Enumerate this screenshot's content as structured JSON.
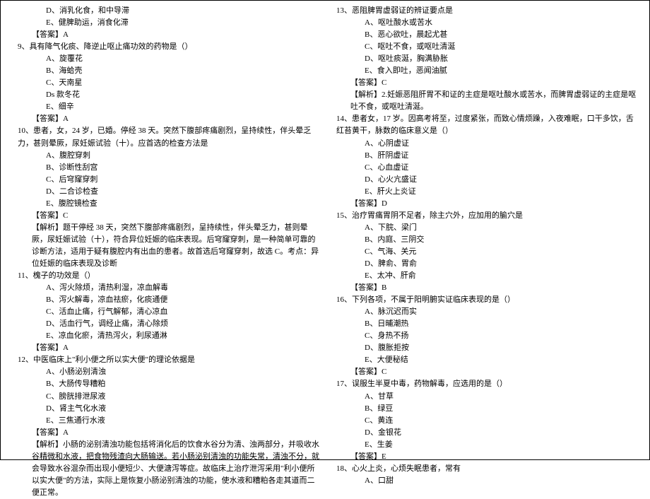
{
  "left": [
    {
      "cls": "indent2",
      "t": "D、消乳化食，和中导滞"
    },
    {
      "cls": "indent2",
      "t": "E、健脾助运，消食化滞"
    },
    {
      "cls": "indent1",
      "t": "【答案】A"
    },
    {
      "cls": "q",
      "t": "9、具有降气化痰、降逆止呕止痛功效的药物是（）"
    },
    {
      "cls": "indent2",
      "t": "A、旋覆花"
    },
    {
      "cls": "indent2",
      "t": "B、海蛤壳"
    },
    {
      "cls": "indent2",
      "t": "C、天南星"
    },
    {
      "cls": "indent2",
      "t": "Ds 款冬花"
    },
    {
      "cls": "indent2",
      "t": "E、细辛"
    },
    {
      "cls": "indent1",
      "t": "【答案】A"
    },
    {
      "cls": "q",
      "t": "10、患者，女，24 岁，已婚。停经 38 天。突然下腹部疼痛剧烈，呈持续性，伴头晕乏力，甚则晕厥，尿妊娠试验（十）。应首选的检查方法是"
    },
    {
      "cls": "indent2",
      "t": "A、腹腔穿刺"
    },
    {
      "cls": "indent2",
      "t": "B、诊断性刮宫"
    },
    {
      "cls": "indent2",
      "t": "C、后穹窿穿刺"
    },
    {
      "cls": "indent2",
      "t": "D、二合诊检查"
    },
    {
      "cls": "indent2",
      "t": "E、腹腔镜检查"
    },
    {
      "cls": "indent1",
      "t": "【答案】C"
    },
    {
      "cls": "indent1",
      "t": "【解析】题干停经 38 天，突然下腹部疼痛剧烈，呈持续性，伴头晕乏力，甚则晕厥，尿妊娠试验（十），符合异位妊娠的临床表现。后穹窿穿刺，是一种简单可靠的诊断方法，适用于疑有腹腔内有出血的患者。故首选后穹窿穿刺，故选 C。考点：异位妊娠的临床表现及诊断"
    },
    {
      "cls": "q",
      "t": "11、槐子的功效是（）"
    },
    {
      "cls": "indent2",
      "t": "A、泻火除烦，清热利湿，凉血解毒"
    },
    {
      "cls": "indent2",
      "t": "B、泻火解毒，凉血祛瘀，化痰通便"
    },
    {
      "cls": "indent2",
      "t": "C、活血止痛，行气解郁，清心凉血"
    },
    {
      "cls": "indent2",
      "t": "D、活血行气，调经止痛，清心除烦"
    },
    {
      "cls": "indent2",
      "t": "E、凉血化瘀，清热泻火，利尿通淋"
    },
    {
      "cls": "indent1",
      "t": "【答案】A"
    },
    {
      "cls": "q",
      "t": "12、中医临床上\"利小便之所以实大便\"的理论依据是"
    },
    {
      "cls": "indent2",
      "t": "A、小肠泌别清浊"
    },
    {
      "cls": "indent2",
      "t": "B、大肠传导糟粕"
    },
    {
      "cls": "indent2",
      "t": "C、膀胱排泄尿液"
    },
    {
      "cls": "indent2",
      "t": "D、肾主气化水液"
    },
    {
      "cls": "indent2",
      "t": "E、三焦通行水液"
    },
    {
      "cls": "indent1",
      "t": "【答案】A"
    },
    {
      "cls": "indent1",
      "t": "【解析】小肠的泌别清浊功能包括将消化后的饮食水谷分为清、浊两部分，并吸收水谷精微和水液，把食物残渣向大肠输送。若小肠泌别清浊的功能失常，清浊不分，就会导致水谷混杂而出现小便短少、大便溏泻等症。故临床上治疗泄泻采用\"利小便所以实大便\"的方法，实际上是恢复小肠泌别清浊的功能，使水液和糟粕各走其道而二便正常。"
    }
  ],
  "right": [
    {
      "cls": "q",
      "t": "13、恶阻脾胃虚弱证的辨证要点是"
    },
    {
      "cls": "indent2",
      "t": "A、呕吐酸水或苦水"
    },
    {
      "cls": "indent2",
      "t": "B、恶心欲吐，晨起尤甚"
    },
    {
      "cls": "indent2",
      "t": "C、呕吐不食，或呕吐清涎"
    },
    {
      "cls": "indent2",
      "t": "D、呕吐痰涎，胸满胁胀"
    },
    {
      "cls": "indent2",
      "t": "E、食入即吐，恶闻油腻"
    },
    {
      "cls": "indent1",
      "t": "【答案】C"
    },
    {
      "cls": "indent1",
      "t": "【解析】2.妊娠恶阻肝胃不和证的主症是呕吐酸水或苦水，而脾胃虚弱证的主症是呕吐不食，或呕吐清涎。"
    },
    {
      "cls": "q",
      "t": "14、患者女，17 岁。因高考将至，过度紧张，而致心情烦躁，入夜难眠，口干多饮，舌红苔黄干，脉数的临床意义是（）"
    },
    {
      "cls": "indent2",
      "t": "A、心阴虚证"
    },
    {
      "cls": "indent2",
      "t": "B、肝阴虚证"
    },
    {
      "cls": "indent2",
      "t": "C、心血虚证"
    },
    {
      "cls": "indent2",
      "t": "D、心火亢盛证"
    },
    {
      "cls": "indent2",
      "t": "E、肝火上炎证"
    },
    {
      "cls": "indent1",
      "t": "【答案】D"
    },
    {
      "cls": "q",
      "t": "15、治疗胃痛胃阴不足者，除主穴外，应加用的腧穴是"
    },
    {
      "cls": "indent2",
      "t": "A、下脘、梁门"
    },
    {
      "cls": "indent2",
      "t": "B、内庭、三阴交"
    },
    {
      "cls": "indent2",
      "t": "C、气海、关元"
    },
    {
      "cls": "indent2",
      "t": "D、脾俞、胃俞"
    },
    {
      "cls": "indent2",
      "t": "E、太冲、肝俞"
    },
    {
      "cls": "indent1",
      "t": "【答案】B"
    },
    {
      "cls": "q",
      "t": "16、下列各项，不属于阳明腑实证临床表现的是（）"
    },
    {
      "cls": "indent2",
      "t": "A、脉沉迟而实"
    },
    {
      "cls": "indent2",
      "t": "B、日晡潮热"
    },
    {
      "cls": "indent2",
      "t": "C、身热不扬"
    },
    {
      "cls": "indent2",
      "t": "D、腹胀拒按"
    },
    {
      "cls": "indent2",
      "t": "E、大便秘结"
    },
    {
      "cls": "indent1",
      "t": "【答案】C"
    },
    {
      "cls": "q",
      "t": "17、误服生半夏中毒，药物解毒，应选用的是（）"
    },
    {
      "cls": "indent2",
      "t": "A、甘草"
    },
    {
      "cls": "indent2",
      "t": "B、绿豆"
    },
    {
      "cls": "indent2",
      "t": "C、黄连"
    },
    {
      "cls": "indent2",
      "t": "D、金银花"
    },
    {
      "cls": "indent2",
      "t": "E、生姜"
    },
    {
      "cls": "indent1",
      "t": "【答案】E"
    },
    {
      "cls": "q",
      "t": "18、心火上炎，心烦失眠患者，常有"
    },
    {
      "cls": "indent2",
      "t": "A、口甜"
    }
  ]
}
